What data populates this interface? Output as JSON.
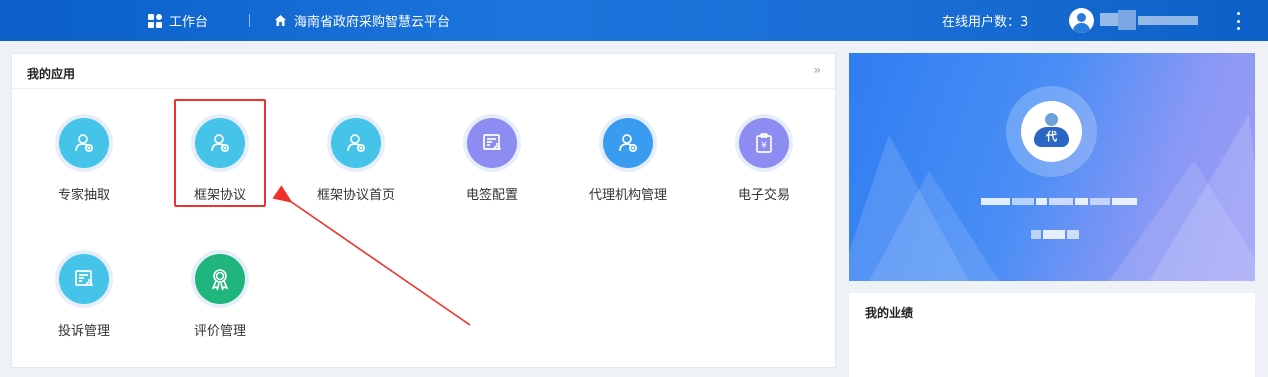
{
  "header": {
    "workbench_label": "工作台",
    "platform_label": "海南省政府采购智慧云平台",
    "online_users_label": "在线用户数：3",
    "icons": {
      "workbench": "grid-icon",
      "platform": "home-icon",
      "avatar": "user-avatar-icon",
      "more": "more-vertical-icon"
    }
  },
  "apps_panel": {
    "title": "我的应用",
    "expand_icon": "double-chevron-right-icon",
    "apps": [
      {
        "label": "专家抽取",
        "icon": "person-x-icon",
        "color": "#45c3e8"
      },
      {
        "label": "框架协议",
        "icon": "person-x-icon",
        "color": "#45c3e8",
        "highlighted": true
      },
      {
        "label": "框架协议首页",
        "icon": "person-x-icon",
        "color": "#45c3e8"
      },
      {
        "label": "电签配置",
        "icon": "document-signature-icon",
        "color": "#8c8cf2"
      },
      {
        "label": "代理机构管理",
        "icon": "person-x-icon",
        "color": "#3a9cf0"
      },
      {
        "label": "电子交易",
        "icon": "yen-clipboard-icon",
        "color": "#8c8cf2"
      },
      {
        "label": "投诉管理",
        "icon": "document-signature-icon",
        "color": "#45c3e8"
      },
      {
        "label": "评价管理",
        "icon": "award-badge-icon",
        "color": "#1fb57c"
      }
    ]
  },
  "profile_card": {
    "avatar_badge": "代"
  },
  "performance": {
    "title": "我的业绩"
  },
  "annotation": {
    "color": "#f0302a"
  }
}
